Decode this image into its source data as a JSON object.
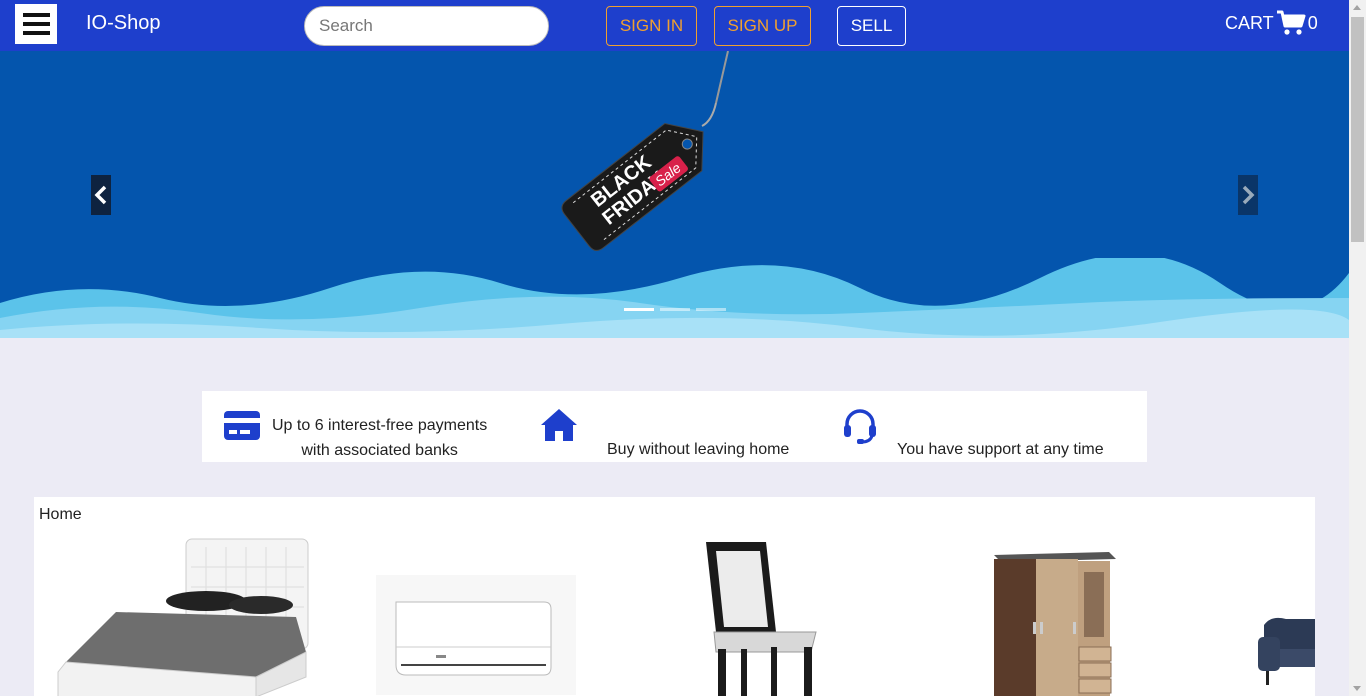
{
  "header": {
    "brand": "IO-Shop",
    "search_placeholder": "Search",
    "signin_label": "SIGN IN",
    "signup_label": "SIGN UP",
    "sell_label": "SELL",
    "cart_label": "CART",
    "cart_count": "0"
  },
  "carousel": {
    "tag_text_line1": "BLACK",
    "tag_text_line2": "FRIDAY",
    "tag_text_line3": "Sale",
    "active_slide": 1,
    "slide_count": 3
  },
  "benefits": [
    {
      "icon": "credit-card-icon",
      "line1": "Up to 6 interest-free payments",
      "line2": "with associated banks"
    },
    {
      "icon": "home-icon",
      "text": "Buy without leaving home"
    },
    {
      "icon": "headset-icon",
      "text": "You have support at any time"
    }
  ],
  "products": {
    "breadcrumb": "Home",
    "items": [
      {
        "name": "bed"
      },
      {
        "name": "air-conditioner"
      },
      {
        "name": "chair"
      },
      {
        "name": "wardrobe"
      },
      {
        "name": "sofa"
      }
    ]
  },
  "colors": {
    "nav_bg": "#1e3fcc",
    "accent_orange": "#f0a030",
    "carousel_bg": "#0455ad",
    "page_bg": "#ecebf5",
    "icon_blue": "#1e3fcc"
  }
}
